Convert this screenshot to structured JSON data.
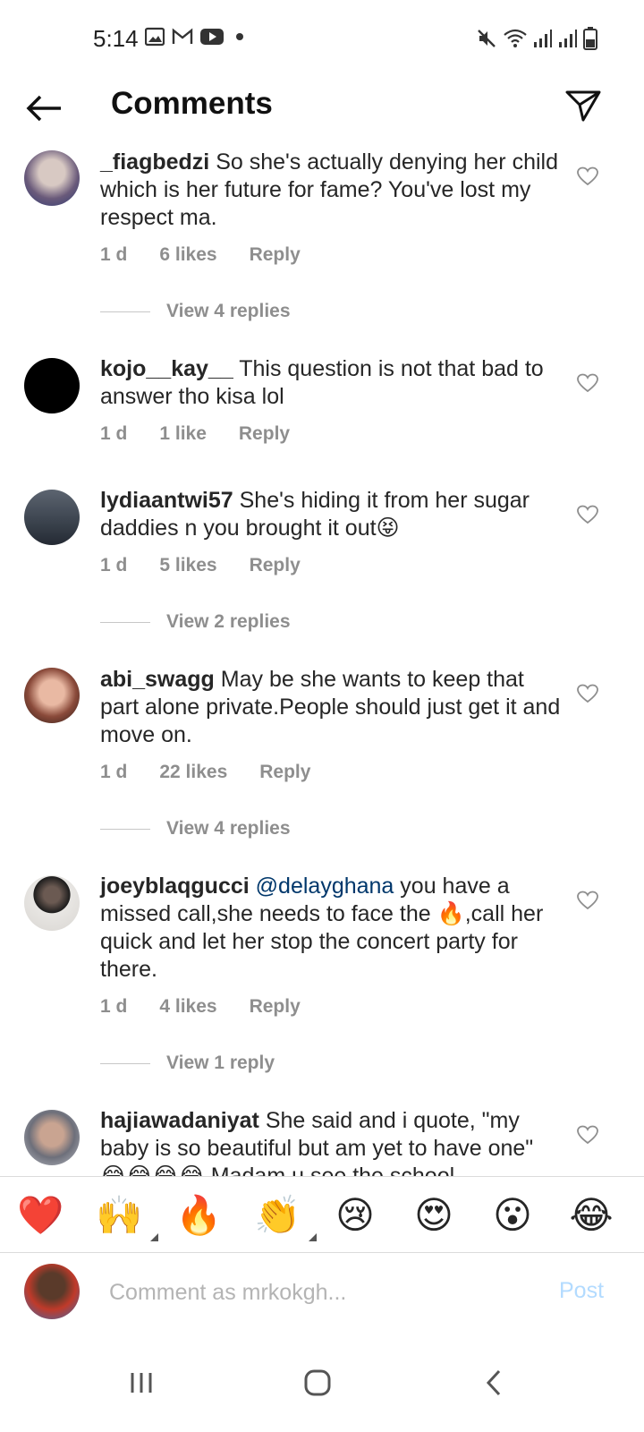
{
  "status_bar": {
    "time": "5:14",
    "left_icons": [
      "gallery-icon",
      "gmail-icon",
      "youtube-icon",
      "notification-dot"
    ],
    "right_icons": [
      "mute-icon",
      "wifi-icon",
      "signal-icon",
      "signal-icon",
      "battery-icon"
    ]
  },
  "header": {
    "title": "Comments",
    "back_icon": "arrow-left-icon",
    "share_icon": "send-icon"
  },
  "comments": [
    {
      "username": "_fiagbedzi",
      "text": "So she's actually denying her child which is her future for fame? You've lost my respect ma.",
      "time": "1 d",
      "likes": "6 likes",
      "reply": "Reply",
      "view_replies": "View 4 replies"
    },
    {
      "username": "kojo__kay__",
      "text": "This question is not that bad to answer tho kisa lol",
      "time": "1 d",
      "likes": "1 like",
      "reply": "Reply"
    },
    {
      "username": "lydiaantwi57",
      "text": "She's hiding it from her sugar daddies n you brought it out😝",
      "time": "1 d",
      "likes": "5 likes",
      "reply": "Reply",
      "view_replies": "View 2 replies"
    },
    {
      "username": "abi_swagg",
      "text": "May be she wants to keep that part alone private.People should just get it and move on.",
      "time": "1 d",
      "likes": "22 likes",
      "reply": "Reply",
      "view_replies": "View 4 replies"
    },
    {
      "username": "joeyblaqgucci",
      "mention": "@delayghana",
      "text": " you have a missed call,she needs to face the 🔥,call her quick and let her stop the concert party for there.",
      "time": "1 d",
      "likes": "4 likes",
      "reply": "Reply",
      "view_replies": "View 1 reply"
    },
    {
      "username": "hajiawadaniyat",
      "text": "She said and i quote, \"my baby is so beautiful but am yet to have one\" 😂😂😂😂 Madam u see the school"
    }
  ],
  "emoji_bar": [
    "❤️",
    "🙌",
    "🔥",
    "👏",
    "😢",
    "😍",
    "😮",
    "😂"
  ],
  "compose": {
    "placeholder": "Comment as mrkokgh...",
    "post_label": "Post"
  },
  "nav_bar": [
    "recent-apps-icon",
    "home-icon",
    "back-icon"
  ],
  "colors": {
    "text": "#262626",
    "meta": "#8e8e8e",
    "mention": "#00376b",
    "post_disabled": "#b3dbff"
  }
}
